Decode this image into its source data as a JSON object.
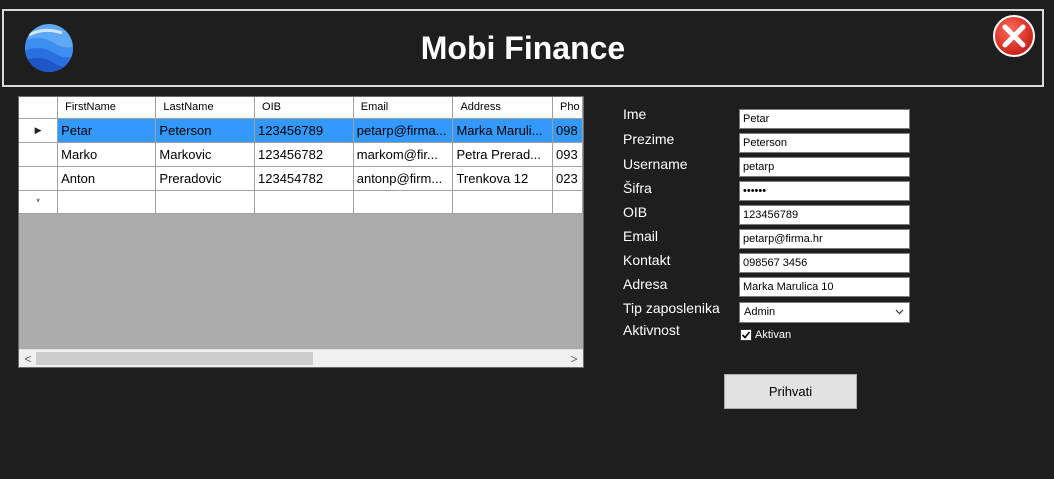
{
  "app": {
    "title": "Mobi Finance",
    "logo_icon": "globe-icon",
    "close_icon": "close-icon"
  },
  "grid": {
    "columns": [
      "FirstName",
      "LastName",
      "OIB",
      "Email",
      "Address",
      "Pho"
    ],
    "rows": [
      [
        "Petar",
        "Peterson",
        "123456789",
        "petarp@firma...",
        "Marka Maruli...",
        "098"
      ],
      [
        "Marko",
        "Markovic",
        "123456782",
        "markom@fir...",
        "Petra Prerad...",
        "093"
      ],
      [
        "Anton",
        "Preradovic",
        "123454782",
        "antonp@firm...",
        "Trenkova 12",
        "023"
      ]
    ],
    "selected_row": 0,
    "current_row_indicator": "▶",
    "new_row_indicator": "*",
    "scroll_left": "<",
    "scroll_right": ">"
  },
  "form": {
    "labels": {
      "ime": "Ime",
      "prezime": "Prezime",
      "username": "Username",
      "sifra": "Šifra",
      "oib": "OIB",
      "email": "Email",
      "kontakt": "Kontakt",
      "adresa": "Adresa",
      "tip": "Tip zaposlenika",
      "aktivnost": "Aktivnost"
    },
    "values": {
      "ime": "Petar",
      "prezime": "Peterson",
      "username": "petarp",
      "sifra": "••••••",
      "oib": "123456789",
      "email": "petarp@firma.hr",
      "kontakt": "098567 3456",
      "adresa": "Marka Marulica 10"
    },
    "tip_selected": "Admin",
    "aktivan_label": "Aktivan",
    "aktivan_checked": true,
    "submit_label": "Prihvati"
  },
  "colors": {
    "background": "#1e1e1e",
    "selection": "#3399ff",
    "close_red": "#e0302a"
  }
}
